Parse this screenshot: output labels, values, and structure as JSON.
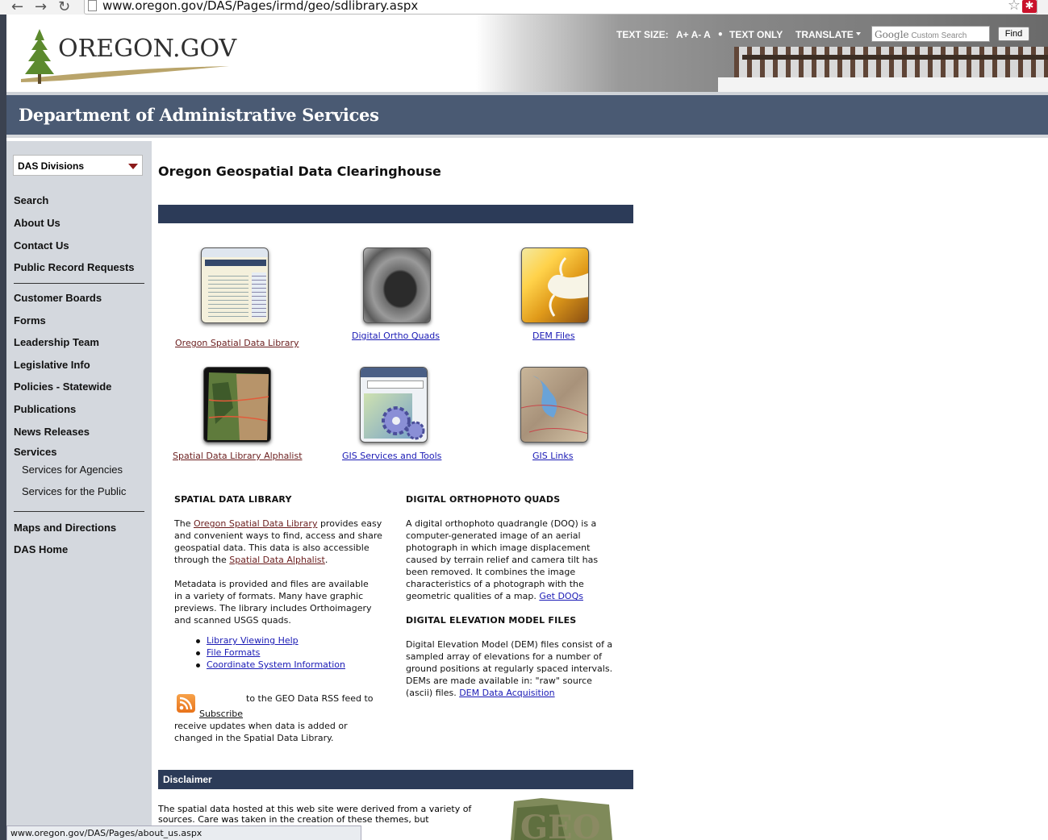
{
  "browser": {
    "url": "www.oregon.gov/DAS/Pages/irmd/geo/sdlibrary.aspx",
    "status_url": "www.oregon.gov/DAS/Pages/about_us.aspx"
  },
  "header": {
    "logo_text": "OREGON.GOV",
    "text_size_label": "TEXT SIZE:",
    "text_size_options": "A+ A- A",
    "bullet": "•",
    "text_only": "TEXT ONLY",
    "translate": "TRANSLATE",
    "search_placeholder_brand": "Google",
    "search_placeholder": "Custom Search",
    "find_label": "Find"
  },
  "banner": {
    "title": "Department of Administrative Services"
  },
  "sidebar": {
    "dropdown": "DAS Divisions",
    "group1": [
      "Search",
      "About Us",
      "Contact Us",
      "Public Record Requests"
    ],
    "group2": [
      "Customer Boards",
      "Forms",
      "Leadership Team",
      "Legislative Info",
      "Policies - Statewide",
      "Publications",
      "News Releases",
      "Services"
    ],
    "services_sub": [
      "Services for Agencies",
      "Services for the Public"
    ],
    "group3": [
      "Maps and Directions",
      "DAS Home"
    ]
  },
  "main": {
    "title": "Oregon Geospatial Data Clearinghouse",
    "tiles": [
      {
        "label": "Oregon Spatial Data Library",
        "icon": "library-screenshot-icon"
      },
      {
        "label": "Digital Ortho Quads",
        "icon": "ortho-photo-icon"
      },
      {
        "label": "DEM Files",
        "icon": "dem-map-icon"
      },
      {
        "label": "Spatial Data Library Alphalist",
        "icon": "oregon-map-icon"
      },
      {
        "label": "GIS Services and Tools",
        "icon": "gears-icon"
      },
      {
        "label": "GIS Links",
        "icon": "topo-map-icon"
      }
    ],
    "sdl": {
      "heading": "SPATIAL DATA LIBRARY",
      "p1_pre": "The ",
      "p1_link1": "Oregon Spatial Data Library",
      "p1_mid": " provides easy and convenient ways to find, access and share geospatial data. This data is also accessible through the ",
      "p1_link2": "Spatial Data Alphalist",
      "p1_post": ".",
      "p2": "Metadata is provided and files are available in a variety of formats. Many have graphic previews. The library includes Orthoimagery and scanned USGS quads.",
      "links": [
        "Library Viewing Help",
        "File Formats",
        "Coordinate System Information"
      ],
      "rss_pre": "to the GEO Data RSS feed to",
      "rss_link": "Subscribe",
      "rss_post": "receive updates when data is added or changed in the Spatial Data Library."
    },
    "doq": {
      "heading": "DIGITAL ORTHOPHOTO QUADS",
      "text": "A digital orthophoto quadrangle (DOQ) is a computer-generated image of an aerial photograph in which image displacement caused by terrain relief and camera tilt has been removed. It combines the image characteristics of a photograph with the geometric qualities of a map. ",
      "link": "Get DOQs"
    },
    "dem": {
      "heading": "DIGITAL ELEVATION MODEL FILES",
      "text": "Digital Elevation Model (DEM) files consist of a sampled array of elevations for a number of ground positions at regularly spaced intervals. DEMs are made available in: \"raw\" source (ascii) files. ",
      "link": "DEM Data Acquisition"
    },
    "disclaimer": {
      "heading": "Disclaimer",
      "text": "The spatial data hosted at this web site were derived from a variety of sources. Care was taken in the creation of these themes, but"
    }
  },
  "colors": {
    "navy": "#2c3b58",
    "banner": "#4a5a73",
    "sidebar": "#d4d8de",
    "visited": "#6b1e1e",
    "link": "#1a1ab5"
  }
}
